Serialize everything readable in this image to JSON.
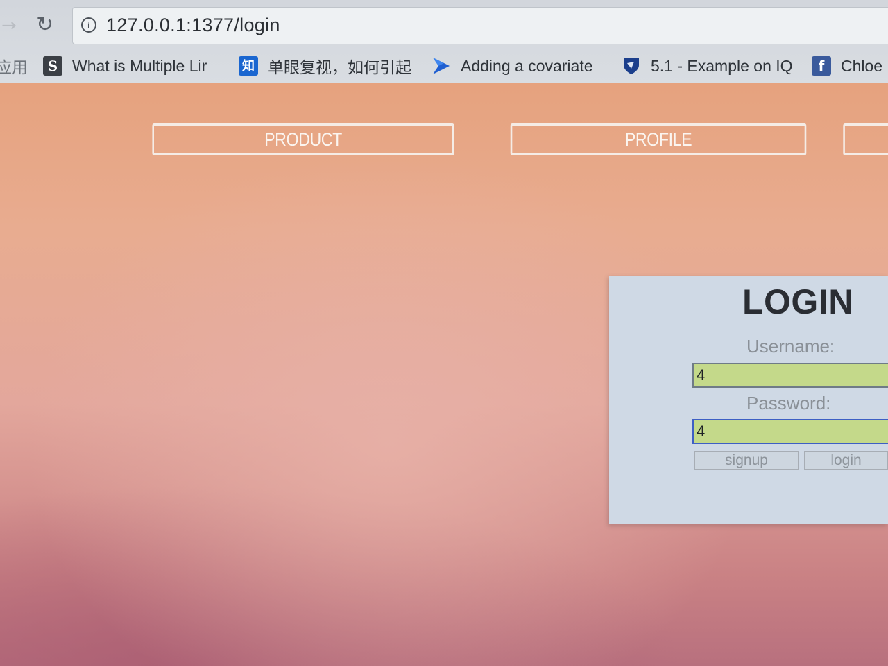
{
  "browser": {
    "url": "127.0.0.1:1377/login",
    "bookmarks": [
      {
        "label": "应用",
        "icon": "apps-icon"
      },
      {
        "label": "What is Multiple Lir",
        "icon": "s-icon"
      },
      {
        "label": "单眼复视，如何引起",
        "icon": "zhihu-icon"
      },
      {
        "label": "Adding a covariate",
        "icon": "arrow-logo-icon"
      },
      {
        "label": "5.1 - Example on IQ",
        "icon": "shield-logo-icon"
      },
      {
        "label": "Chloe",
        "icon": "facebook-icon"
      }
    ]
  },
  "nav": {
    "items": [
      "PRODUCT",
      "PROFILE",
      ""
    ]
  },
  "login": {
    "title": "LOGIN",
    "username_label": "Username:",
    "username_value": "4",
    "password_label": "Password:",
    "password_value": "4",
    "signup_label": "signup",
    "login_label": "login"
  },
  "colors": {
    "page_top": "#e6a27e",
    "page_bottom": "#b8707e",
    "panel_bg": "#cfd9e5",
    "input_bg": "#c4d98a",
    "focus_border": "#3e5fc4"
  }
}
